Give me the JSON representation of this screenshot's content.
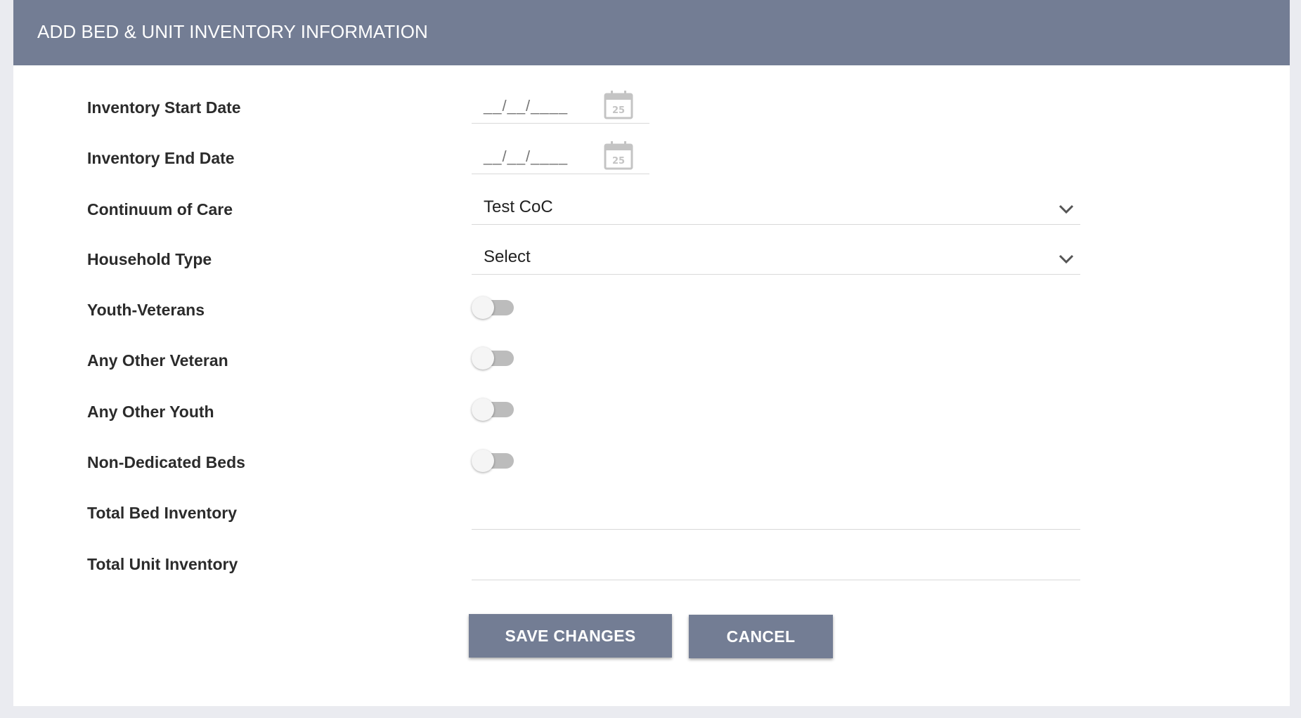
{
  "header": {
    "title": "ADD BED & UNIT INVENTORY INFORMATION",
    "color": "#737d94"
  },
  "fields": {
    "inventory_start_date": {
      "label": "Inventory Start Date",
      "mask": "__/__/____",
      "calendar_day": "25"
    },
    "inventory_end_date": {
      "label": "Inventory End Date",
      "mask": "__/__/____",
      "calendar_day": "25"
    },
    "continuum_of_care": {
      "label": "Continuum of Care",
      "value": "Test CoC"
    },
    "household_type": {
      "label": "Household Type",
      "value": "Select"
    },
    "youth_veterans": {
      "label": "Youth-Veterans"
    },
    "any_other_veteran": {
      "label": "Any Other Veteran"
    },
    "any_other_youth": {
      "label": "Any Other Youth"
    },
    "non_dedicated_beds": {
      "label": "Non-Dedicated Beds"
    },
    "total_bed_inventory": {
      "label": "Total Bed Inventory",
      "value": ""
    },
    "total_unit_inventory": {
      "label": "Total Unit Inventory",
      "value": ""
    }
  },
  "toggles": {
    "youth_veterans": false,
    "any_other_veteran": false,
    "any_other_youth": false,
    "non_dedicated_beds": false
  },
  "actions": {
    "save_label": "SAVE CHANGES",
    "cancel_label": "CANCEL"
  },
  "icons": {
    "calendar": "calendar-icon",
    "chevron": "chevron-down-icon"
  }
}
